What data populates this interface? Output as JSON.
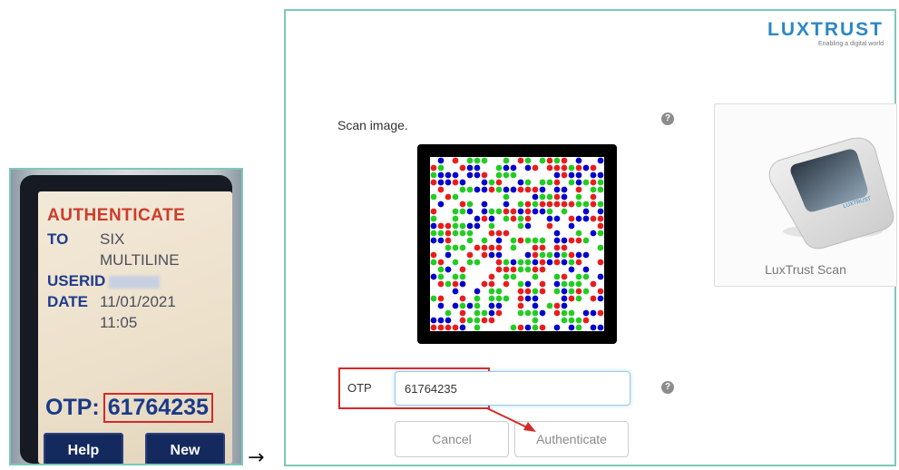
{
  "device": {
    "title": "AUTHENTICATE",
    "to_key": "TO",
    "to_line1": "SIX",
    "to_line2": "MULTILINE",
    "userid_key": "USERID",
    "date_key": "DATE",
    "date_value": "11/01/2021",
    "time_value": "11:05",
    "otp_label": "OTP:",
    "otp_value": "61764235",
    "help_button": "Help",
    "new_button": "New"
  },
  "arrow": "→",
  "web": {
    "logo": "LUXTRUST",
    "logo_tagline": "Enabling a digital world",
    "scan_label": "Scan image.",
    "help_icon": "?",
    "card_caption": "LuxTrust Scan",
    "otp_label": "OTP",
    "otp_value": "61764235",
    "cancel_button": "Cancel",
    "authenticate_button": "Authenticate"
  },
  "colors": {
    "qr_dots": [
      "#0000cc",
      "#e81c1c",
      "#22cc22"
    ],
    "highlight": "#d62828",
    "frame": "#7fc8b8",
    "logo": "#2d87c6"
  }
}
